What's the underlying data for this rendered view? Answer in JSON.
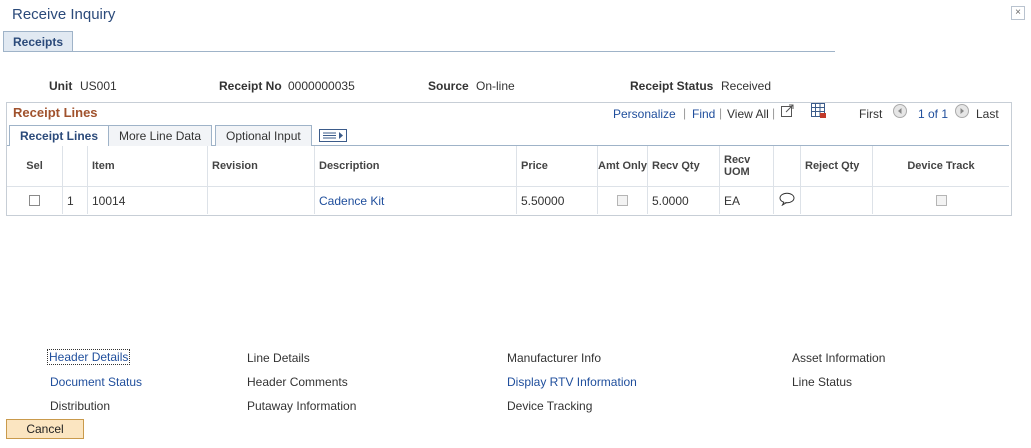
{
  "page": {
    "title": "Receive Inquiry",
    "close_icon": "close-icon"
  },
  "page_tab": "Receipts",
  "header_fields": {
    "unit_label": "Unit",
    "unit_value": "US001",
    "receipt_no_label": "Receipt No",
    "receipt_no_value": "0000000035",
    "source_label": "Source",
    "source_value": "On-line",
    "status_label": "Receipt Status",
    "status_value": "Received"
  },
  "grid": {
    "title": "Receipt Lines",
    "nav": {
      "personalize": "Personalize",
      "find": "Find",
      "view_all": "View All",
      "first": "First",
      "range": "1 of 1",
      "last": "Last"
    },
    "tabs": [
      "Receipt Lines",
      "More Line Data",
      "Optional Input"
    ],
    "columns": {
      "sel": "Sel",
      "item": "Item",
      "revision": "Revision",
      "description": "Description",
      "price": "Price",
      "amt_only": "Amt Only",
      "recv_qty": "Recv Qty",
      "recv_uom": "Recv UOM",
      "reject_qty": "Reject Qty",
      "device_track": "Device Track"
    },
    "rows": [
      {
        "num": "1",
        "item": "10014",
        "revision": "",
        "description": "Cadence Kit",
        "price": "5.50000",
        "recv_qty": "5.0000",
        "recv_uom": "EA",
        "reject_qty": ""
      }
    ]
  },
  "links": {
    "header_details": "Header Details",
    "line_details": "Line Details",
    "manufacturer_info": "Manufacturer Info",
    "asset_information": "Asset Information",
    "document_status": "Document Status",
    "header_comments": "Header Comments",
    "display_rtv_information": "Display RTV Information",
    "line_status": "Line Status",
    "distribution": "Distribution",
    "putaway_information": "Putaway Information",
    "device_tracking": "Device Tracking"
  },
  "buttons": {
    "cancel": "Cancel"
  },
  "colors": {
    "link": "#1f4e9c",
    "grid_title": "#a0522d",
    "button_bg": "#fbe5c1",
    "header_text": "#2b4a7a"
  }
}
